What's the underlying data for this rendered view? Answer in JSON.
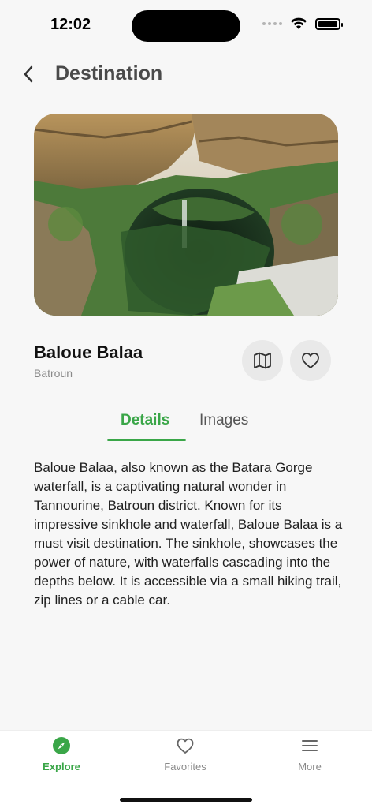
{
  "status_bar": {
    "time": "12:02"
  },
  "header": {
    "title": "Destination"
  },
  "place": {
    "name": "Baloue Balaa",
    "region": "Batroun"
  },
  "tabs": [
    {
      "label": "Details",
      "active": true
    },
    {
      "label": "Images",
      "active": false
    }
  ],
  "description": "Baloue Balaa, also known as the Batara Gorge waterfall, is a captivating natural wonder in Tannourine, Batroun district. Known for its impressive sinkhole and waterfall, Baloue Balaa is a must visit destination. The sinkhole, showcases the power of nature, with waterfalls cascading into the depths below. It is accessible via a small hiking trail, zip lines or a cable car.",
  "bottom_nav": [
    {
      "label": "Explore",
      "icon": "compass-icon",
      "active": true
    },
    {
      "label": "Favorites",
      "icon": "heart-icon",
      "active": false
    },
    {
      "label": "More",
      "icon": "menu-icon",
      "active": false
    }
  ],
  "colors": {
    "accent": "#3aa648",
    "background": "#f7f7f7"
  }
}
